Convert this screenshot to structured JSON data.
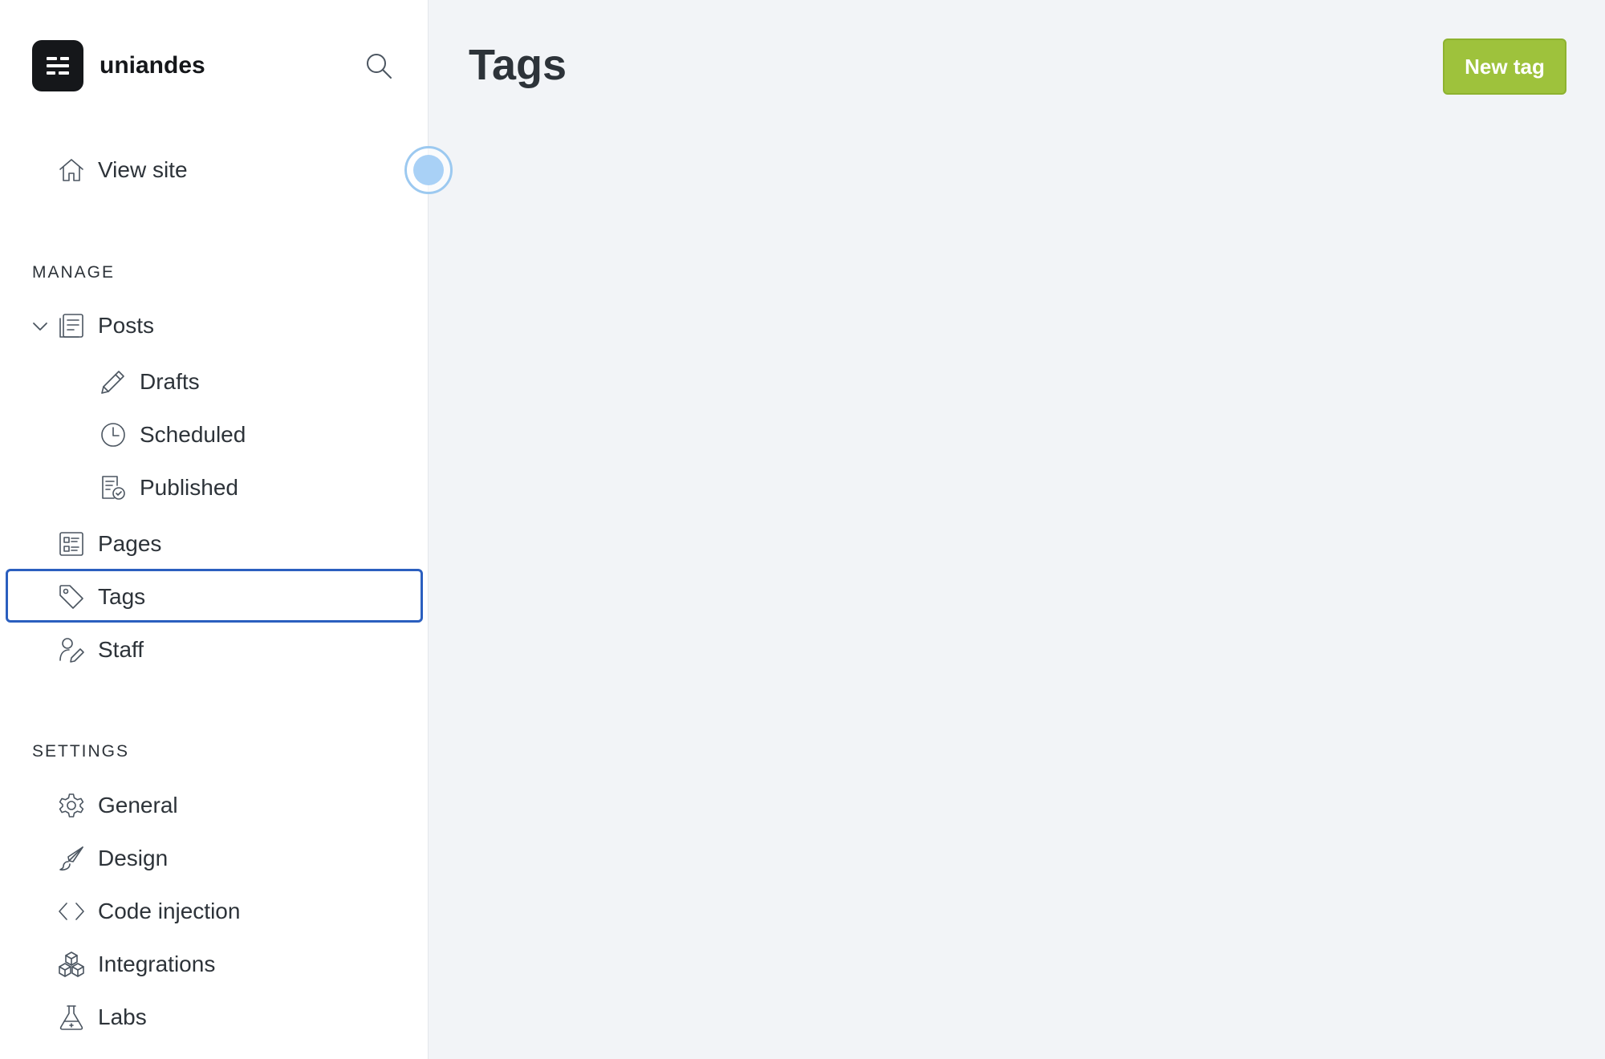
{
  "brand": {
    "name": "uniandes",
    "logo_icon": "ghost-menu-icon"
  },
  "search": {
    "icon": "search-icon"
  },
  "sidebar": {
    "view_site": {
      "label": "View site",
      "icon": "home-icon"
    },
    "manage_heading": "MANAGE",
    "manage_items": [
      {
        "label": "Posts",
        "icon": "posts-icon",
        "expanded": true
      },
      {
        "label": "Drafts",
        "icon": "pencil-icon"
      },
      {
        "label": "Scheduled",
        "icon": "clock-icon"
      },
      {
        "label": "Published",
        "icon": "published-icon"
      },
      {
        "label": "Pages",
        "icon": "pages-icon"
      },
      {
        "label": "Tags",
        "icon": "tag-icon",
        "active": true
      },
      {
        "label": "Staff",
        "icon": "staff-icon"
      }
    ],
    "settings_heading": "SETTINGS",
    "settings_items": [
      {
        "label": "General",
        "icon": "gear-icon"
      },
      {
        "label": "Design",
        "icon": "brush-icon"
      },
      {
        "label": "Code injection",
        "icon": "code-icon"
      },
      {
        "label": "Integrations",
        "icon": "integrations-icon"
      },
      {
        "label": "Labs",
        "icon": "flask-icon"
      }
    ]
  },
  "main": {
    "title": "Tags",
    "new_tag_label": "New tag"
  },
  "colors": {
    "accent_green": "#9ec23c",
    "active_outline": "#2b5fbf",
    "sidebar_bg": "#ffffff",
    "main_bg": "#f2f4f7"
  }
}
